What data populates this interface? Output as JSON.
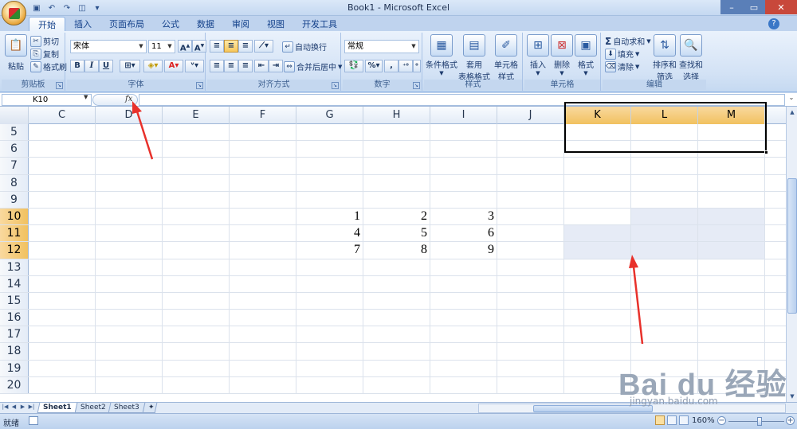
{
  "window": {
    "title": "Book1 - Microsoft Excel",
    "controls": [
      "minimize",
      "maximize",
      "close"
    ]
  },
  "quick_access": {
    "icons": [
      "save-icon",
      "undo-icon",
      "redo-icon",
      "print-preview-icon",
      "customize-qat-icon"
    ]
  },
  "tabs": [
    {
      "label": "开始",
      "active": true
    },
    {
      "label": "插入"
    },
    {
      "label": "页面布局"
    },
    {
      "label": "公式"
    },
    {
      "label": "数据"
    },
    {
      "label": "审阅"
    },
    {
      "label": "视图"
    },
    {
      "label": "开发工具"
    }
  ],
  "ribbon": {
    "clipboard": {
      "label": "剪贴板",
      "paste": "粘贴",
      "cut": "剪切",
      "copy": "复制",
      "format_painter": "格式刷"
    },
    "font": {
      "label": "字体",
      "font_name": "宋体",
      "font_size": "11",
      "bold": "B",
      "italic": "I",
      "underline": "U"
    },
    "alignment": {
      "label": "对齐方式",
      "wrap_text": "自动换行",
      "merge_center": "合并后居中"
    },
    "number": {
      "label": "数字",
      "format": "常规",
      "percent": "%",
      "comma": ","
    },
    "styles": {
      "label": "样式",
      "conditional": "条件格式",
      "format_table_1": "套用",
      "format_table_2": "表格格式",
      "cell_styles_1": "单元格",
      "cell_styles_2": "样式"
    },
    "cells": {
      "label": "单元格",
      "insert": "插入",
      "delete": "删除",
      "format": "格式"
    },
    "editing": {
      "label": "编辑",
      "autosum": "自动求和",
      "fill": "填充",
      "clear": "清除",
      "sort_filter_1": "排序和",
      "sort_filter_2": "筛选",
      "find_select_1": "查找和",
      "find_select_2": "选择"
    }
  },
  "formula_bar": {
    "name_box": "K10",
    "fx": "fx",
    "formula": ""
  },
  "columns": [
    "C",
    "D",
    "E",
    "F",
    "G",
    "H",
    "I",
    "J",
    "K",
    "L",
    "M"
  ],
  "selected_columns": [
    "K",
    "L",
    "M"
  ],
  "rows": [
    {
      "num": "5",
      "cells": [
        "",
        "",
        "",
        "",
        "",
        "",
        "",
        "",
        "",
        "",
        ""
      ]
    },
    {
      "num": "6",
      "cells": [
        "",
        "",
        "",
        "",
        "",
        "",
        "",
        "",
        "",
        "",
        ""
      ]
    },
    {
      "num": "7",
      "cells": [
        "",
        "",
        "",
        "",
        "",
        "",
        "",
        "",
        "",
        "",
        ""
      ]
    },
    {
      "num": "8",
      "cells": [
        "",
        "",
        "",
        "",
        "",
        "",
        "",
        "",
        "",
        "",
        ""
      ]
    },
    {
      "num": "9",
      "cells": [
        "",
        "",
        "",
        "",
        "",
        "",
        "",
        "",
        "",
        "",
        ""
      ]
    },
    {
      "num": "10",
      "cells": [
        "",
        "",
        "",
        "",
        "1",
        "2",
        "3",
        "",
        "",
        "",
        ""
      ],
      "selected": true
    },
    {
      "num": "11",
      "cells": [
        "",
        "",
        "",
        "",
        "4",
        "5",
        "6",
        "",
        "",
        "",
        ""
      ],
      "selected": true
    },
    {
      "num": "12",
      "cells": [
        "",
        "",
        "",
        "",
        "7",
        "8",
        "9",
        "",
        "",
        "",
        ""
      ],
      "selected": true
    },
    {
      "num": "13",
      "cells": [
        "",
        "",
        "",
        "",
        "",
        "",
        "",
        "",
        "",
        "",
        ""
      ]
    },
    {
      "num": "14",
      "cells": [
        "",
        "",
        "",
        "",
        "",
        "",
        "",
        "",
        "",
        "",
        ""
      ]
    },
    {
      "num": "15",
      "cells": [
        "",
        "",
        "",
        "",
        "",
        "",
        "",
        "",
        "",
        "",
        ""
      ]
    },
    {
      "num": "16",
      "cells": [
        "",
        "",
        "",
        "",
        "",
        "",
        "",
        "",
        "",
        "",
        ""
      ]
    },
    {
      "num": "17",
      "cells": [
        "",
        "",
        "",
        "",
        "",
        "",
        "",
        "",
        "",
        "",
        ""
      ]
    },
    {
      "num": "18",
      "cells": [
        "",
        "",
        "",
        "",
        "",
        "",
        "",
        "",
        "",
        "",
        ""
      ]
    },
    {
      "num": "19",
      "cells": [
        "",
        "",
        "",
        "",
        "",
        "",
        "",
        "",
        "",
        "",
        ""
      ]
    },
    {
      "num": "20",
      "cells": [
        "",
        "",
        "",
        "",
        "",
        "",
        "",
        "",
        "",
        "",
        ""
      ]
    }
  ],
  "sheets": [
    {
      "label": "Sheet1",
      "active": true
    },
    {
      "label": "Sheet2"
    },
    {
      "label": "Sheet3"
    }
  ],
  "status": {
    "mode": "就绪",
    "zoom": "160%",
    "zoom_minus": "−",
    "zoom_plus": "+"
  },
  "watermark": {
    "brand": "Bai du 经验",
    "sub": "jingyan.baidu.com"
  },
  "colors": {
    "selection_border": "#000000",
    "selection_fill": "#e6ebf6",
    "annotation_arrow": "#e8312b",
    "header_selected": "#f1c15f"
  }
}
